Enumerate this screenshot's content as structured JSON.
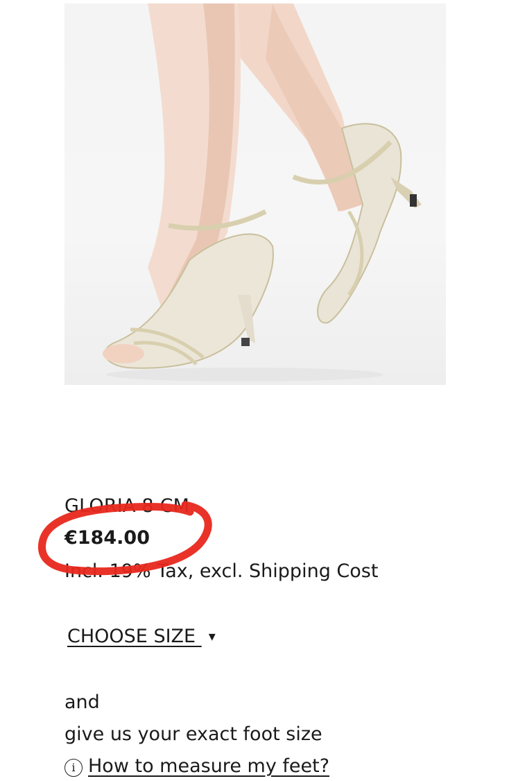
{
  "product": {
    "title": "GLORIA 8 CM",
    "price": "€184.00",
    "tax_note": "Incl. 19% Tax, excl. Shipping Cost",
    "image_icon": "product-photo"
  },
  "size": {
    "label": "CHOOSE SIZE ",
    "arrow": "▾",
    "arrow_icon": "caret-down-icon"
  },
  "foot": {
    "and_text": "and",
    "instruction": "give us your exact foot size",
    "info_icon_glyph": "i",
    "info_icon": "info-icon",
    "link_text": "How to measure my feet?"
  },
  "colors": {
    "highlight": "#e8281e",
    "text": "#1a1a1a"
  }
}
